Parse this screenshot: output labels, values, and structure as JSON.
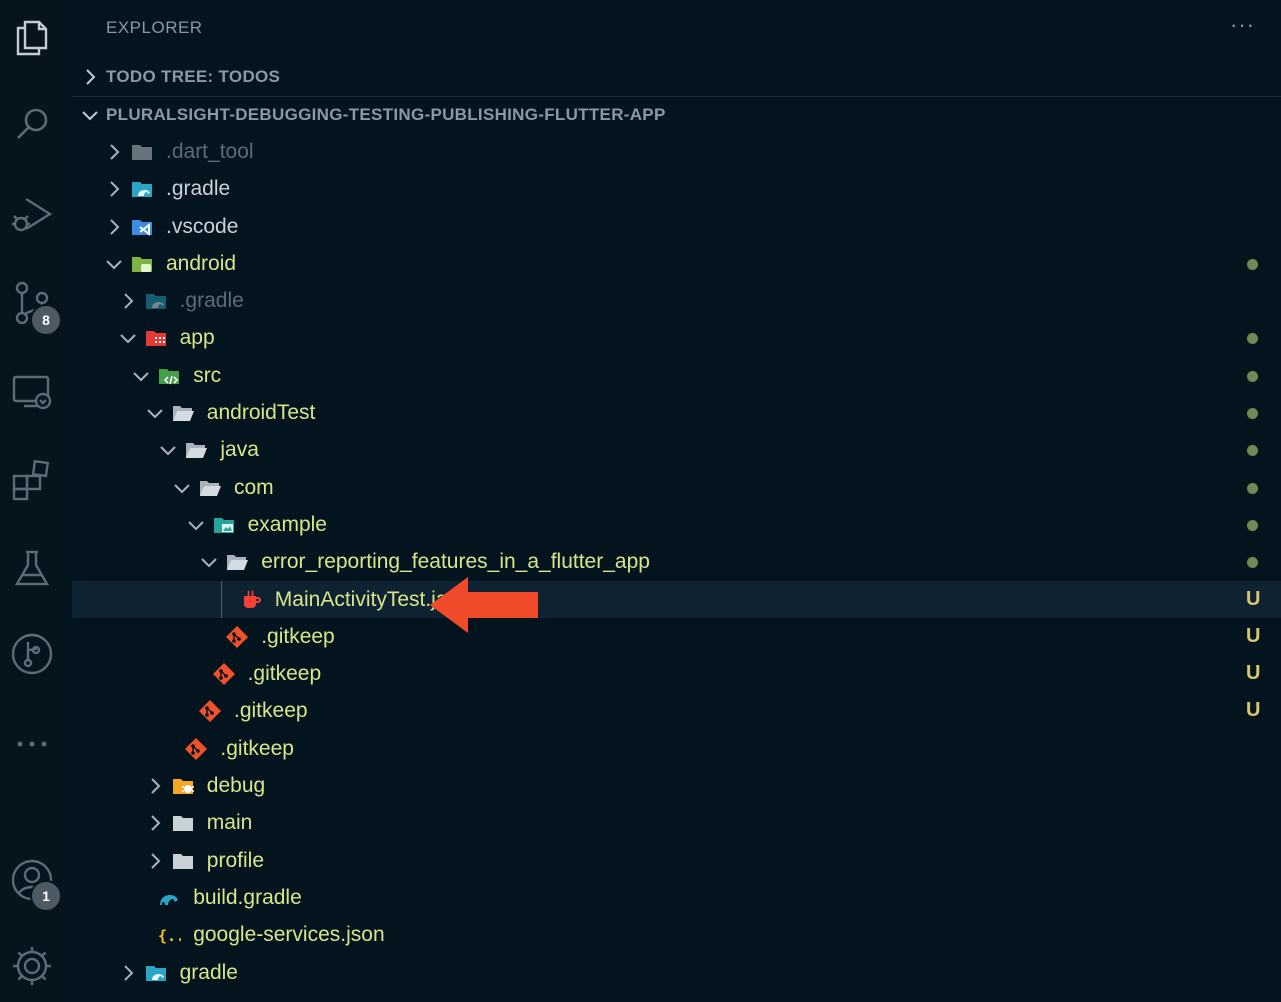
{
  "activity_bar": {
    "scm_badge": "8",
    "accounts_badge": "1"
  },
  "sidebar": {
    "title": "EXPLORER",
    "more_actions": "···",
    "todo_section": "TODO TREE: TODOS",
    "workspace_section": "PLURALSIGHT-DEBUGGING-TESTING-PUBLISHING-FLUTTER-APP"
  },
  "tree": [
    {
      "label": ".dart_tool",
      "depth": 0,
      "chevron": "right",
      "icon": "folder-gray-icon",
      "dimmed": true
    },
    {
      "label": ".gradle",
      "depth": 0,
      "chevron": "right",
      "icon": "gradle-folder-icon"
    },
    {
      "label": ".vscode",
      "depth": 0,
      "chevron": "right",
      "icon": "vscode-folder-icon"
    },
    {
      "label": "android",
      "depth": 0,
      "chevron": "down",
      "icon": "android-folder-icon",
      "modified": true,
      "status": "dot"
    },
    {
      "label": ".gradle",
      "depth": 1,
      "chevron": "right",
      "icon": "gradle-folder-icon",
      "dimmed": true
    },
    {
      "label": "app",
      "depth": 1,
      "chevron": "down",
      "icon": "app-folder-icon",
      "modified": true,
      "status": "dot"
    },
    {
      "label": "src",
      "depth": 2,
      "chevron": "down",
      "icon": "src-folder-icon",
      "modified": true,
      "status": "dot"
    },
    {
      "label": "androidTest",
      "depth": 3,
      "chevron": "down",
      "icon": "folder-open-icon",
      "modified": true,
      "status": "dot"
    },
    {
      "label": "java",
      "depth": 4,
      "chevron": "down",
      "icon": "folder-open-icon",
      "modified": true,
      "status": "dot"
    },
    {
      "label": "com",
      "depth": 5,
      "chevron": "down",
      "icon": "folder-open-icon",
      "modified": true,
      "status": "dot"
    },
    {
      "label": "example",
      "depth": 6,
      "chevron": "down",
      "icon": "example-folder-icon",
      "modified": true,
      "status": "dot"
    },
    {
      "label": "error_reporting_features_in_a_flutter_app",
      "depth": 7,
      "chevron": "down",
      "icon": "folder-open-icon",
      "modified": true,
      "status": "dot"
    },
    {
      "label": "MainActivityTest.java",
      "depth": 8,
      "chevron": "none",
      "icon": "java-file-icon",
      "modified": true,
      "status": "U",
      "selected": true
    },
    {
      "label": ".gitkeep",
      "depth": 7,
      "chevron": "none",
      "icon": "git-file-icon",
      "modified": true,
      "status": "U"
    },
    {
      "label": ".gitkeep",
      "depth": 6,
      "chevron": "none",
      "icon": "git-file-icon",
      "modified": true,
      "status": "U"
    },
    {
      "label": ".gitkeep",
      "depth": 5,
      "chevron": "none",
      "icon": "git-file-icon",
      "modified": true,
      "status": "U"
    },
    {
      "label": ".gitkeep",
      "depth": 4,
      "chevron": "none",
      "icon": "git-file-icon"
    },
    {
      "label": "debug",
      "depth": 3,
      "chevron": "right",
      "icon": "debug-folder-icon"
    },
    {
      "label": "main",
      "depth": 3,
      "chevron": "right",
      "icon": "folder-gray-icon"
    },
    {
      "label": "profile",
      "depth": 3,
      "chevron": "right",
      "icon": "folder-gray-icon"
    },
    {
      "label": "build.gradle",
      "depth": 2,
      "chevron": "none",
      "icon": "gradle-file-icon"
    },
    {
      "label": "google-services.json",
      "depth": 2,
      "chevron": "none",
      "icon": "json-file-icon"
    },
    {
      "label": "gradle",
      "depth": 1,
      "chevron": "right",
      "icon": "gradle-folder-icon"
    }
  ],
  "colors": {
    "background": "#04141f",
    "modified_text": "#d8e68a",
    "normal_text": "#c9d1d9",
    "dimmed_text": "#5d6b78",
    "untracked_status": "#d8c66a",
    "modified_dot": "#6f8a52",
    "arrow": "#ef4b2a"
  }
}
